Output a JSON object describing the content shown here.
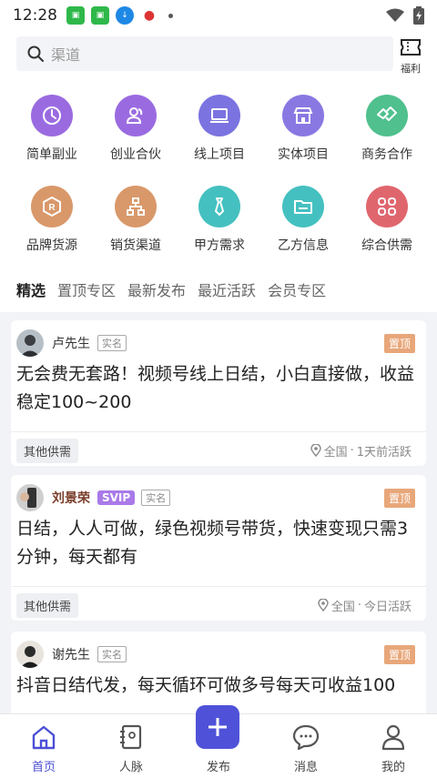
{
  "status_bar": {
    "time": "12:28",
    "icons": [
      "app-green-icon",
      "app-green-icon",
      "download-icon",
      "app-red-icon",
      "dot-icon",
      "wifi-icon",
      "battery-icon"
    ]
  },
  "search": {
    "placeholder": "渠道",
    "benefit_label": "福利"
  },
  "categories": [
    {
      "label": "简单副业",
      "icon": "clock-icon",
      "color": "#9a6be0"
    },
    {
      "label": "创业合伙",
      "icon": "people-icon",
      "color": "#9a6be0"
    },
    {
      "label": "线上项目",
      "icon": "laptop-icon",
      "color": "#7b73e0"
    },
    {
      "label": "实体项目",
      "icon": "store-icon",
      "color": "#8a78e2"
    },
    {
      "label": "商务合作",
      "icon": "handshake-icon",
      "color": "#4fc08e"
    },
    {
      "label": "品牌货源",
      "icon": "registered-icon",
      "color": "#d9986a"
    },
    {
      "label": "销货渠道",
      "icon": "network-icon",
      "color": "#d9986a"
    },
    {
      "label": "甲方需求",
      "icon": "tie-icon",
      "color": "#45c0c0"
    },
    {
      "label": "乙方信息",
      "icon": "folder-icon",
      "color": "#45c0c0"
    },
    {
      "label": "综合供需",
      "icon": "grid-icon",
      "color": "#e0666e"
    }
  ],
  "tabs": [
    "精选",
    "置顶专区",
    "最新发布",
    "最近活跃",
    "会员专区"
  ],
  "posts": [
    {
      "author": "卢先生",
      "svip": "",
      "verified": "实名",
      "pinned": "置顶",
      "title": "无会费无套路！视频号线上日结，小白直接做，收益稳定100~200",
      "tag": "其他供需",
      "location": "全国",
      "activity": "1天前活跃"
    },
    {
      "author": "刘景荣",
      "svip": "SVIP",
      "verified": "实名",
      "pinned": "置顶",
      "title": "日结，人人可做，绿色视频号带货，快速变现只需3分钟，每天都有",
      "tag": "其他供需",
      "location": "全国",
      "activity": "今日活跃"
    },
    {
      "author": "谢先生",
      "svip": "",
      "verified": "实名",
      "pinned": "置顶",
      "title": "抖音日结代发，每天循环可做多号每天可收益100"
    }
  ],
  "bottom_nav": {
    "home": "首页",
    "contacts": "人脉",
    "publish": "发布",
    "messages": "消息",
    "mine": "我的"
  },
  "colors": {
    "accent": "#4f52d8",
    "pinned": "#e8a77a",
    "svip": "#a97ae8"
  }
}
